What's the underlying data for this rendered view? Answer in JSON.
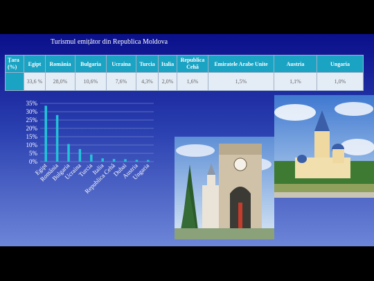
{
  "slide": {
    "title": "Turismul emițător din Republica Moldova"
  },
  "table": {
    "header_label": [
      "Țara",
      "(%)"
    ],
    "columns": [
      "Egipt",
      "România",
      "Bulgaria",
      "Ucraina",
      "Turcia",
      "Italia",
      "Republica Cehă",
      "Emiratele Arabe Unite",
      "Austria",
      "Ungaria"
    ],
    "values": [
      "33,6 %",
      "28,0%",
      "10,6%",
      "7,6%",
      "4,3%",
      "2,0%",
      "1,6%",
      "1,5%",
      "1,1%",
      "1,0%"
    ]
  },
  "chart_data": {
    "type": "bar",
    "categories": [
      "Egipt",
      "România",
      "Bulgaria",
      "Ucraina",
      "Turcia",
      "Italia",
      "Republica Cehă",
      "Dubai",
      "Austria",
      "Ungaria"
    ],
    "values": [
      33.6,
      28.0,
      10.6,
      7.6,
      4.3,
      2.0,
      1.6,
      1.5,
      1.1,
      1.0
    ],
    "yticks": [
      "0%",
      "5%",
      "10%",
      "15%",
      "20%",
      "25%",
      "30%",
      "35%"
    ],
    "ylim": [
      0,
      35
    ],
    "grid": true,
    "bar_color": "#22c4d8",
    "title": "",
    "xlabel": "",
    "ylabel": ""
  },
  "photos": {
    "photo1": "triumphal-arch-and-cathedral-bell-tower",
    "photo2": "orthodox-church-with-blue-domes"
  }
}
